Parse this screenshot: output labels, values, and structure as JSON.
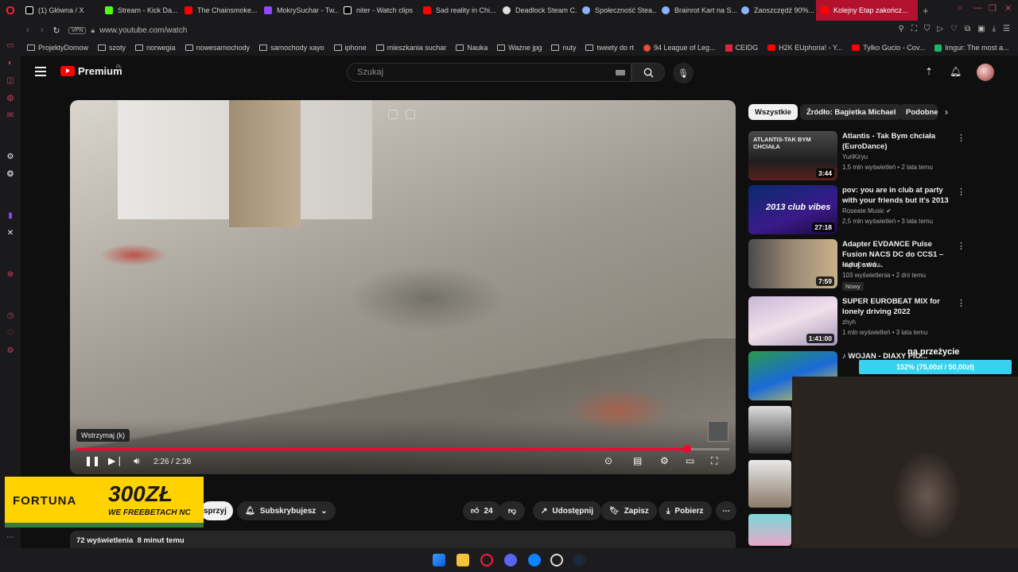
{
  "browser": {
    "tabs": [
      {
        "label": "(1) Główna / X",
        "icon_color": "#ffffff"
      },
      {
        "label": "Stream - Kick Da...",
        "icon_color": "#53fc18"
      },
      {
        "label": "The Chainsmoke...",
        "icon_color": "#ff0000"
      },
      {
        "label": "MokrySuchar - Tw...",
        "icon_color": "#9146ff"
      },
      {
        "label": "niter - Watch clips",
        "icon_color": "#ffffff"
      },
      {
        "label": "Sad reality in Chi...",
        "icon_color": "#ff0000"
      },
      {
        "label": "Deadlock Steam C...",
        "icon_color": "#ffffff"
      },
      {
        "label": "Społeczność Stea...",
        "icon_color": "#8ab4f8"
      },
      {
        "label": "Brainrot Kart na S...",
        "icon_color": "#8ab4f8"
      },
      {
        "label": "Zaoszczędź 90%...",
        "icon_color": "#8ab4f8"
      },
      {
        "label": "Kolejny Etap zakończ...",
        "icon_color": "#ff0000",
        "active": true
      }
    ],
    "vpn_label": "VPN",
    "url": "www.youtube.com/watch",
    "bookmarks": [
      "ProjektyDomow",
      "szoty",
      "norwegia",
      "nowesamochody",
      "samochody xayo",
      "iphone",
      "mieszkania suchar",
      "Nauka",
      "Ważne jpg",
      "nuty",
      "tweety do rt",
      "94 League of Leg...",
      "CEIDG",
      "H2K EUphoria! - Y...",
      "Tylko Gucio - Cov...",
      "Imgur: The most a..."
    ]
  },
  "youtube": {
    "logo_text": "Premium",
    "logo_region": "PL",
    "search_placeholder": "Szukaj",
    "accent_color": "#ff0033"
  },
  "player": {
    "tooltip": "Wstrzymaj (k)",
    "time_current": "2:26",
    "time_total": "2:36",
    "progress_fraction": 0.936
  },
  "below_video": {
    "subscribe_partial": "sprzyj",
    "subscribed_label": "Subskrybujesz",
    "like_count": "24",
    "share_label": "Udostępnij",
    "save_label": "Zapisz",
    "download_label": "Pobierz",
    "views": "72 wyświetlenia",
    "published": "8 minut temu"
  },
  "ad": {
    "brand": "FORTUNA",
    "amount": "300ZŁ",
    "tagline": "WE FREEBETACH NC"
  },
  "chips": [
    {
      "label": "Wszystkie",
      "active": true
    },
    {
      "label": "Źródło: Bagietka Michael",
      "active": false
    },
    {
      "label": "Podobne",
      "active": false
    }
  ],
  "recommendations": [
    {
      "title": "Atlantis - Tak Bym chciała (EuroDance)",
      "channel": "YuriKiryu",
      "meta": "1,5 mln wyświetleń • 2 lata temu",
      "duration": "3:44",
      "thumb_text": "ATLANTIS-TAK BYM CHCIAŁA"
    },
    {
      "title": "pov: you are in club at party with your friends but it's 2013",
      "channel": "Roseate Music ✔",
      "meta": "2,5 mln wyświetleń • 3 lata temu",
      "duration": "27:18",
      "thumb_text": "2013 club vibes"
    },
    {
      "title": "Adapter EVDANCE Pulse Fusion NACS DC do CCS1 – ładuj swó...",
      "channel": "High On Cars",
      "meta": "103 wyświetlenia • 2 dni temu",
      "duration": "7:59",
      "badge": "Nowy"
    },
    {
      "title": "SUPER EUROBEAT MIX for lonely driving 2022",
      "channel": "zhyh",
      "meta": "1 mln wyświetleń • 3 lata temu",
      "duration": "1:41:00"
    },
    {
      "title": "♪ WOJAN - DIAXY PIO...",
      "channel": "",
      "meta": "",
      "duration": ""
    }
  ],
  "overlay": {
    "donation_label": "na przeżycie",
    "donation_progress": "152% (75,00zł / 50,00zł)"
  }
}
